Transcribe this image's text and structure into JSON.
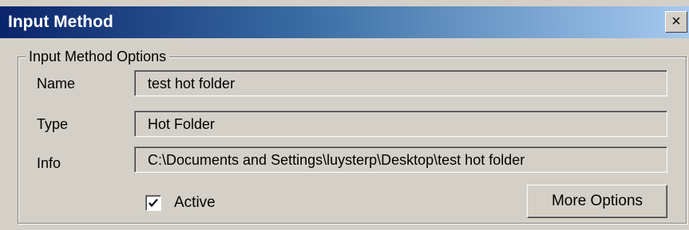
{
  "window": {
    "title": "Input Method",
    "close_glyph": "×"
  },
  "group": {
    "legend": "Input Method Options"
  },
  "fields": {
    "name_label": "Name",
    "name_value": "test hot folder",
    "type_label": "Type",
    "type_value": "Hot Folder",
    "info_label": "Info",
    "info_value": "C:\\Documents and Settings\\luysterp\\Desktop\\test hot folder"
  },
  "active": {
    "label": "Active",
    "checked": true
  },
  "buttons": {
    "more_options": "More Options"
  },
  "colors": {
    "titlebar_start": "#0a246a",
    "titlebar_end": "#a6caf0",
    "window_bg": "#d4d0c8"
  },
  "icons": {
    "close": "close-icon",
    "check": "checkmark-icon"
  }
}
